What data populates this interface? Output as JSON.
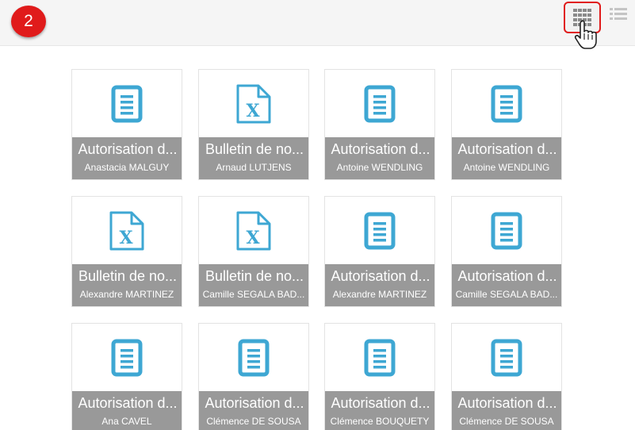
{
  "step_badge": "2",
  "toolbar": {
    "grid_view_icon": "grid-view-icon",
    "list_view_icon": "list-view-icon"
  },
  "colors": {
    "icon_blue": "#3ea7d3",
    "caption_gray": "#999999",
    "accent_red": "#e01b1b"
  },
  "documents": [
    {
      "type": "doc",
      "title": "Autorisation d...",
      "owner": "Anastacia MALGUY"
    },
    {
      "type": "excel",
      "title": "Bulletin de no...",
      "owner": "Arnaud LUTJENS"
    },
    {
      "type": "doc",
      "title": "Autorisation d...",
      "owner": "Antoine WENDLING"
    },
    {
      "type": "doc",
      "title": "Autorisation d...",
      "owner": "Antoine WENDLING"
    },
    {
      "type": "excel",
      "title": "Bulletin de no...",
      "owner": "Alexandre MARTINEZ"
    },
    {
      "type": "excel",
      "title": "Bulletin de no...",
      "owner": "Camille SEGALA BAD..."
    },
    {
      "type": "doc",
      "title": "Autorisation d...",
      "owner": "Alexandre MARTINEZ"
    },
    {
      "type": "doc",
      "title": "Autorisation d...",
      "owner": "Camille SEGALA BAD..."
    },
    {
      "type": "doc",
      "title": "Autorisation d...",
      "owner": "Ana CAVEL"
    },
    {
      "type": "doc",
      "title": "Autorisation d...",
      "owner": "Clémence DE SOUSA"
    },
    {
      "type": "doc",
      "title": "Autorisation d...",
      "owner": "Clémence BOUQUETY"
    },
    {
      "type": "doc",
      "title": "Autorisation d...",
      "owner": "Clémence DE SOUSA"
    }
  ]
}
